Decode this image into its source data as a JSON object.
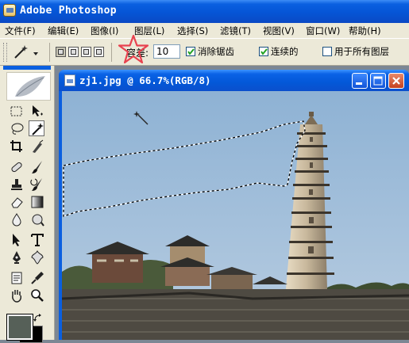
{
  "app": {
    "title": "Adobe Photoshop"
  },
  "menu": [
    {
      "label": "文件(F)"
    },
    {
      "label": "编辑(E)"
    },
    {
      "label": "图像(I)"
    },
    {
      "label": "图层(L)"
    },
    {
      "label": "选择(S)"
    },
    {
      "label": "滤镜(T)"
    },
    {
      "label": "视图(V)"
    },
    {
      "label": "窗口(W)"
    },
    {
      "label": "帮助(H)"
    }
  ],
  "options": {
    "tolerance_label": "容差:",
    "tolerance_value": "10",
    "anti_alias_label": "消除锯齿",
    "anti_alias_checked": true,
    "contiguous_label": "连续的",
    "contiguous_checked": true,
    "all_layers_label": "用于所有图层",
    "all_layers_checked": false
  },
  "toolbox": {
    "active_tool": "magic-wand",
    "foreground_color": "#566058",
    "background_color": "#000000"
  },
  "document": {
    "title": "zj1.jpg @ 66.7%(RGB/8)",
    "zoom_percent": 66.7,
    "color_mode": "RGB/8"
  },
  "colors": {
    "titlebar_blue": "#0a5fe0",
    "chrome": "#ece9d8",
    "highlight_star": "#e8424f"
  }
}
